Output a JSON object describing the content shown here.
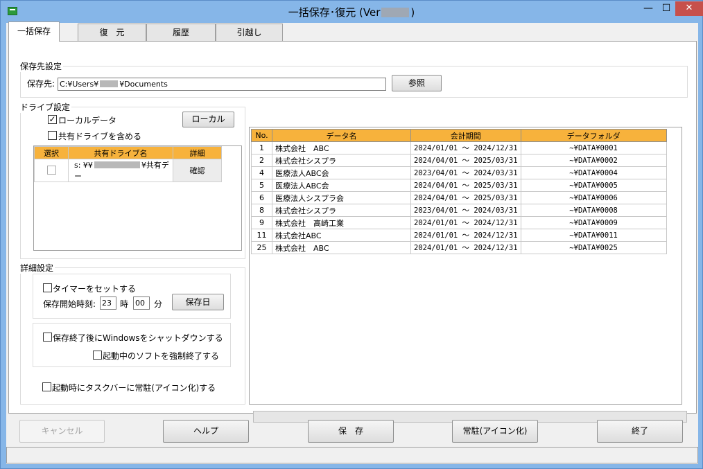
{
  "window": {
    "title_prefix": "一括保存･復元 (Ver",
    "title_suffix": ")",
    "min_glyph": "—",
    "max_glyph": "☐",
    "close_glyph": "✕"
  },
  "tabs": [
    {
      "label": "一括保存"
    },
    {
      "label": "復　元"
    },
    {
      "label": "履歴"
    },
    {
      "label": "引越し"
    }
  ],
  "save_dest": {
    "group_title": "保存先設定",
    "label": "保存先:",
    "path_prefix": "C:¥Users¥",
    "path_suffix": "¥Documents",
    "browse_label": "参照"
  },
  "drive": {
    "group_title": "ドライブ設定",
    "local_data_label": "ローカルデータ",
    "local_data_checked": true,
    "include_shared_label": "共有ドライブを含める",
    "include_shared_checked": false,
    "local_button": "ローカル",
    "headers": [
      "選択",
      "共有ドライブ名",
      "詳細"
    ],
    "row": {
      "drive_prefix": "s: ¥¥",
      "drive_suffix": "¥共有デー",
      "detail": "確認"
    }
  },
  "detail": {
    "group_title": "詳細設定",
    "timer_label": "タイマーをセットする",
    "start_time_label": "保存開始時刻:",
    "hour": "23",
    "hour_unit": "時",
    "minute": "00",
    "minute_unit": "分",
    "save_day_button": "保存日",
    "shutdown_label": "保存終了後にWindowsをシャットダウンする",
    "force_quit_label": "起動中のソフトを強制終了する",
    "taskbar_label": "起動時にタスクバーに常駐(アイコン化)する"
  },
  "list": {
    "headers": [
      "No.",
      "データ名",
      "会計期間",
      "データフォルダ"
    ],
    "rows": [
      {
        "no": "1",
        "name": "株式会社　ABC",
        "period": "2024/01/01 ～ 2024/12/31",
        "folder": "~¥DATA¥0001"
      },
      {
        "no": "2",
        "name": "株式会社シスプラ",
        "period": "2024/04/01 ～ 2025/03/31",
        "folder": "~¥DATA¥0002"
      },
      {
        "no": "4",
        "name": "医療法人ABC会",
        "period": "2023/04/01 ～ 2024/03/31",
        "folder": "~¥DATA¥0004"
      },
      {
        "no": "5",
        "name": "医療法人ABC会",
        "period": "2024/04/01 ～ 2025/03/31",
        "folder": "~¥DATA¥0005"
      },
      {
        "no": "6",
        "name": "医療法人シスプラ会",
        "period": "2024/04/01 ～ 2025/03/31",
        "folder": "~¥DATA¥0006"
      },
      {
        "no": "8",
        "name": "株式会社シスプラ",
        "period": "2023/04/01 ～ 2024/03/31",
        "folder": "~¥DATA¥0008"
      },
      {
        "no": "9",
        "name": "株式会社　高崎工業",
        "period": "2024/01/01 ～ 2024/12/31",
        "folder": "~¥DATA¥0009"
      },
      {
        "no": "11",
        "name": "株式会社ABC",
        "period": "2024/01/01 ～ 2024/12/31",
        "folder": "~¥DATA¥0011"
      },
      {
        "no": "25",
        "name": "株式会社　ABC",
        "period": "2024/01/01 ～ 2024/12/31",
        "folder": "~¥DATA¥0025"
      }
    ]
  },
  "buttons": {
    "cancel": "キャンセル",
    "help": "ヘルプ",
    "save": "保　存",
    "resident": "常駐(アイコン化)",
    "exit": "終了"
  }
}
